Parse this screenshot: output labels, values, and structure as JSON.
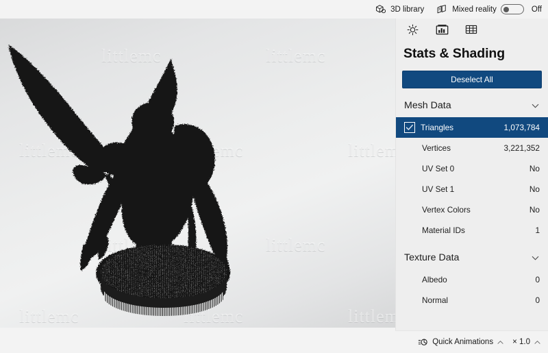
{
  "topbar": {
    "library": {
      "label": "3D library",
      "icon": "cube-library-icon"
    },
    "mixed_reality": {
      "label": "Mixed reality",
      "icon": "mixed-reality-icon",
      "toggle_state": "Off",
      "toggle_on": false
    }
  },
  "panel": {
    "tabs": [
      {
        "name": "lighting-tab",
        "icon": "sun-icon",
        "selected": false
      },
      {
        "name": "stats-shading-tab",
        "icon": "stats-icon",
        "selected": true
      },
      {
        "name": "grid-tab",
        "icon": "grid-icon",
        "selected": false
      }
    ],
    "title": "Stats & Shading",
    "deselect_label": "Deselect All",
    "accent_color": "#11497f",
    "sections": [
      {
        "title": "Mesh Data",
        "expanded": true,
        "rows": [
          {
            "name": "Triangles",
            "value": "1,073,784",
            "selected": true,
            "checkbox": true
          },
          {
            "name": "Vertices",
            "value": "3,221,352",
            "selected": false,
            "checkbox": false
          },
          {
            "name": "UV Set 0",
            "value": "No",
            "selected": false,
            "checkbox": false
          },
          {
            "name": "UV Set 1",
            "value": "No",
            "selected": false,
            "checkbox": false
          },
          {
            "name": "Vertex Colors",
            "value": "No",
            "selected": false,
            "checkbox": false
          },
          {
            "name": "Material IDs",
            "value": "1",
            "selected": false,
            "checkbox": false
          }
        ]
      },
      {
        "title": "Texture Data",
        "expanded": true,
        "rows": [
          {
            "name": "Albedo",
            "value": "0",
            "selected": false,
            "checkbox": false
          },
          {
            "name": "Normal",
            "value": "0",
            "selected": false,
            "checkbox": false
          }
        ]
      }
    ]
  },
  "bottombar": {
    "quick_animations": {
      "label": "Quick Animations",
      "icon": "animation-icon",
      "chevron": "chevron-up-icon"
    },
    "speed": {
      "label": "× 1.0",
      "chevron": "chevron-up-icon"
    }
  },
  "viewport": {
    "watermark_text": "littlemc",
    "model_description": "wireframe warrior statue with eagle on round base"
  }
}
